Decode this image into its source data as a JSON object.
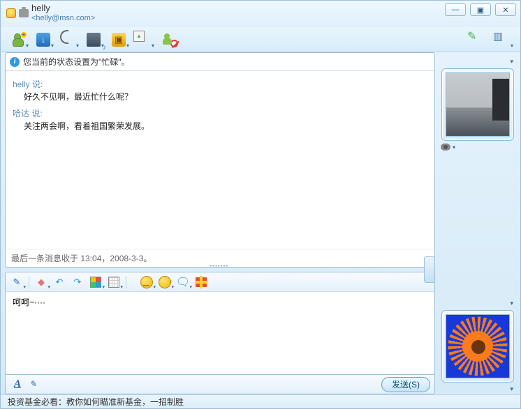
{
  "contact": {
    "name": "helly",
    "email": "<helly@msn.com>"
  },
  "window_controls": {
    "min": "—",
    "max": "▣",
    "close": "✕"
  },
  "status_line": "您当前的状态设置为\"忙碌\"。",
  "messages": [
    {
      "from": "helly  说:",
      "body": "好久不见啊，最近忙什么呢？"
    },
    {
      "from": "哈达   说:",
      "body": "关注两会啊，看着祖国繁荣发展。"
    }
  ],
  "last_received": "最后一条消息收于 13:04，2008-3-3。",
  "compose_text": "呵呵~····",
  "send_label": "发送(S)",
  "webcam_dd": "▾",
  "ad_text": "投资基金必看：教你如何瞄准新基金，一招制胜",
  "toolbar_icons": [
    "invite",
    "files",
    "phone",
    "video",
    "games",
    "activities",
    "block"
  ],
  "right_icons": [
    "color-brush",
    "expand-pane"
  ],
  "format_icons": [
    "pen",
    "eraser",
    "undo",
    "redo",
    "colors",
    "background",
    "emoticon",
    "wink",
    "voice-clip",
    "gift"
  ]
}
